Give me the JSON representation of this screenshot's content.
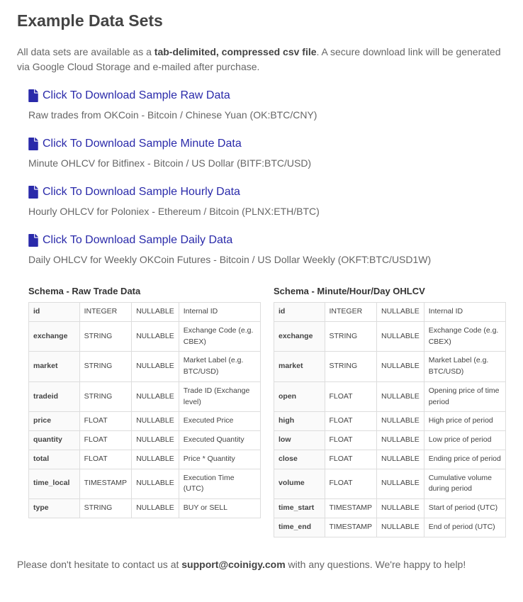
{
  "title": "Example Data Sets",
  "intro_prefix": "All data sets are available as a ",
  "intro_bold": "tab-delimited, compressed csv file",
  "intro_suffix": ". A secure download link will be generated via Google Cloud Storage and e-mailed after purchase.",
  "downloads": [
    {
      "label": "Click To Download Sample Raw Data",
      "desc": "Raw trades from OKCoin - Bitcoin / Chinese Yuan (OK:BTC/CNY)"
    },
    {
      "label": "Click To Download Sample Minute Data",
      "desc": "Minute OHLCV for Bitfinex - Bitcoin / US Dollar (BITF:BTC/USD)"
    },
    {
      "label": "Click To Download Sample Hourly Data",
      "desc": "Hourly OHLCV for Poloniex - Ethereum / Bitcoin (PLNX:ETH/BTC)"
    },
    {
      "label": "Click To Download Sample Daily Data",
      "desc": "Daily OHLCV for Weekly OKCoin Futures - Bitcoin / US Dollar Weekly (OKFT:BTC/USD1W)"
    }
  ],
  "schema_raw": {
    "title": "Schema - Raw Trade Data",
    "rows": [
      {
        "name": "id",
        "type": "INTEGER",
        "null": "NULLABLE",
        "desc": "Internal ID"
      },
      {
        "name": "exchange",
        "type": "STRING",
        "null": "NULLABLE",
        "desc": "Exchange Code (e.g. CBEX)"
      },
      {
        "name": "market",
        "type": "STRING",
        "null": "NULLABLE",
        "desc": "Market Label (e.g. BTC/USD)"
      },
      {
        "name": "tradeid",
        "type": "STRING",
        "null": "NULLABLE",
        "desc": "Trade ID (Exchange level)"
      },
      {
        "name": "price",
        "type": "FLOAT",
        "null": "NULLABLE",
        "desc": "Executed Price"
      },
      {
        "name": "quantity",
        "type": "FLOAT",
        "null": "NULLABLE",
        "desc": "Executed Quantity"
      },
      {
        "name": "total",
        "type": "FLOAT",
        "null": "NULLABLE",
        "desc": "Price * Quantity"
      },
      {
        "name": "time_local",
        "type": "TIMESTAMP",
        "null": "NULLABLE",
        "desc": "Execution Time (UTC)"
      },
      {
        "name": "type",
        "type": "STRING",
        "null": "NULLABLE",
        "desc": "BUY or SELL"
      }
    ]
  },
  "schema_ohlcv": {
    "title": "Schema - Minute/Hour/Day OHLCV",
    "rows": [
      {
        "name": "id",
        "type": "INTEGER",
        "null": "NULLABLE",
        "desc": "Internal ID"
      },
      {
        "name": "exchange",
        "type": "STRING",
        "null": "NULLABLE",
        "desc": "Exchange Code (e.g. CBEX)"
      },
      {
        "name": "market",
        "type": "STRING",
        "null": "NULLABLE",
        "desc": "Market Label (e.g. BTC/USD)"
      },
      {
        "name": "open",
        "type": "FLOAT",
        "null": "NULLABLE",
        "desc": "Opening price of time period"
      },
      {
        "name": "high",
        "type": "FLOAT",
        "null": "NULLABLE",
        "desc": "High price of period"
      },
      {
        "name": "low",
        "type": "FLOAT",
        "null": "NULLABLE",
        "desc": "Low price of period"
      },
      {
        "name": "close",
        "type": "FLOAT",
        "null": "NULLABLE",
        "desc": "Ending price of period"
      },
      {
        "name": "volume",
        "type": "FLOAT",
        "null": "NULLABLE",
        "desc": "Cumulative volume during period"
      },
      {
        "name": "time_start",
        "type": "TIMESTAMP",
        "null": "NULLABLE",
        "desc": "Start of period (UTC)"
      },
      {
        "name": "time_end",
        "type": "TIMESTAMP",
        "null": "NULLABLE",
        "desc": "End of period (UTC)"
      }
    ]
  },
  "contact_prefix": "Please don't hesitate to contact us at ",
  "contact_email": "support@coinigy.com",
  "contact_suffix": " with any questions. We're happy to help!"
}
